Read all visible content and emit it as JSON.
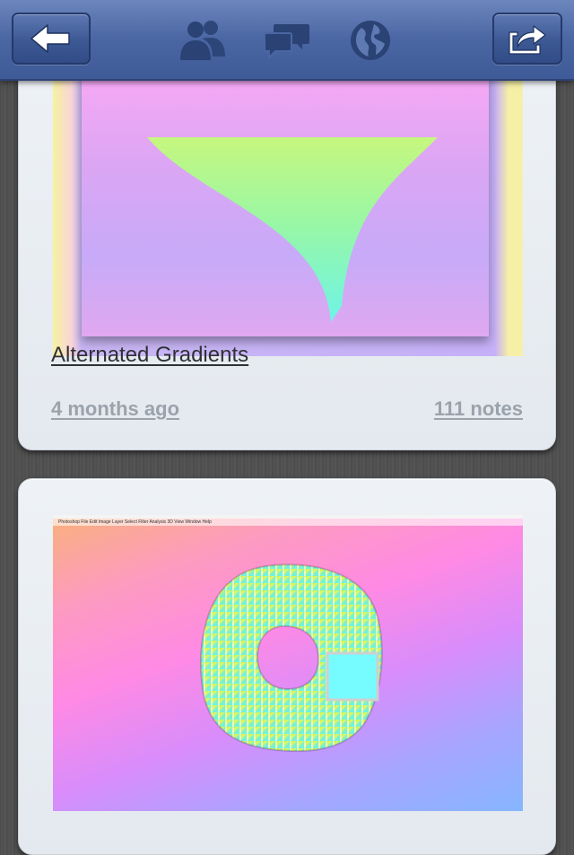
{
  "nav": {
    "back_icon": "back-arrow-icon",
    "people_icon": "people-icon",
    "messages_icon": "chat-bubbles-icon",
    "globe_icon": "globe-icon",
    "share_icon": "share-icon"
  },
  "posts": [
    {
      "title": "Alternated Gradients",
      "time": "4 months ago",
      "notes": "111 notes"
    },
    {
      "menubar": "Photoshop  File  Edit  Image  Layer  Select  Filter  Analysis  3D  View  Window  Help"
    }
  ],
  "colors": {
    "nav_bar": "#4a66a3",
    "card_background": "#e9edf2",
    "meta_text": "#9aa2ab",
    "title_text": "#2f3134"
  }
}
